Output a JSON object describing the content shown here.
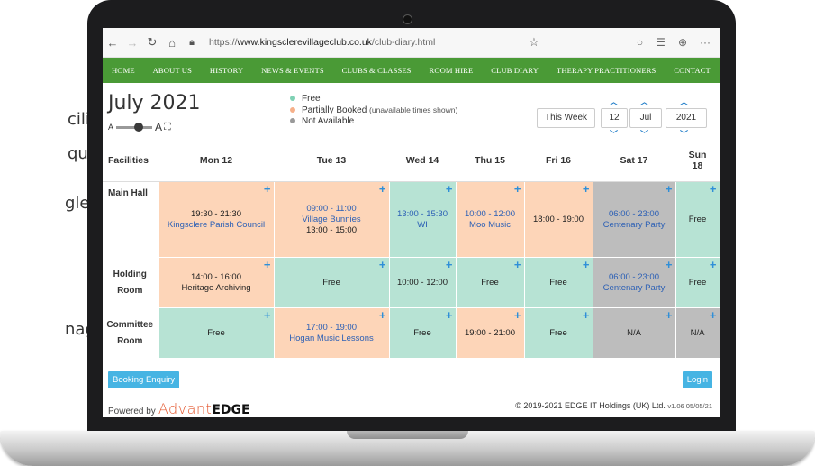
{
  "marketing": [
    "cilities.",
    "quiries",
    "gle",
    "nage"
  ],
  "browser": {
    "url_prefix": "https://",
    "url_domain": "www.kingsclerevillageclub.co.uk",
    "url_path": "/club-diary.html"
  },
  "nav": [
    "HOME",
    "ABOUT US",
    "HISTORY",
    "NEWS & EVENTS",
    "CLUBS & CLASSES",
    "ROOM HIRE",
    "CLUB DIARY",
    "THERAPY PRACTITIONERS",
    "CONTACT"
  ],
  "header": {
    "month_title": "July 2021",
    "zoom_small": "A",
    "zoom_large": "A",
    "legend": {
      "free": "Free",
      "partial": "Partially Booked",
      "partial_note": "(unavailable times shown)",
      "na": "Not Available"
    },
    "this_week": "This Week",
    "day": "12",
    "month": "Jul",
    "year": "2021"
  },
  "colors": {
    "nav_green": "#4a9a36",
    "free": "#b7e3d4",
    "partial": "#fdd5b8",
    "not_available": "#bdbdbd",
    "accent_blue": "#2f8fd8",
    "button_blue": "#46b4e3"
  },
  "table": {
    "facilities_header": "Facilities",
    "days": [
      "Mon 12",
      "Tue 13",
      "Wed 14",
      "Thu 15",
      "Fri 16",
      "Sat 17"
    ],
    "sun_day": "Sun",
    "sun_date": "18",
    "rows": [
      {
        "name": "Main Hall",
        "cells": [
          {
            "status": "part",
            "time": "19:30 - 21:30",
            "event": "Kingsclere Parish Council"
          },
          {
            "status": "part",
            "time": "09:00 - 11:00",
            "event": "Village Bunnies",
            "extra": "13:00 - 15:00"
          },
          {
            "status": "free",
            "time": "13:00 - 15:30",
            "event": "WI"
          },
          {
            "status": "part",
            "time": "10:00 - 12:00",
            "event": "Moo Music"
          },
          {
            "status": "part",
            "time": "18:00 - 19:00"
          },
          {
            "status": "na",
            "time": "06:00 - 23:00",
            "event": "Centenary Party"
          },
          {
            "status": "free",
            "time": "Free"
          }
        ]
      },
      {
        "name_line1": "Holding",
        "name_line2": "Room",
        "cells": [
          {
            "status": "part",
            "time": "14:00 - 16:00",
            "event": "Heritage Archiving"
          },
          {
            "status": "free",
            "time": "Free"
          },
          {
            "status": "free",
            "time": "10:00 - 12:00"
          },
          {
            "status": "free",
            "time": "Free"
          },
          {
            "status": "free",
            "time": "Free"
          },
          {
            "status": "na",
            "time": "06:00 - 23:00",
            "event": "Centenary Party"
          },
          {
            "status": "free",
            "time": "Free"
          }
        ]
      },
      {
        "name_line1": "Committee",
        "name_line2": "Room",
        "cells": [
          {
            "status": "free",
            "time": "Free"
          },
          {
            "status": "part",
            "time": "17:00 - 19:00",
            "event": "Hogan Music Lessons"
          },
          {
            "status": "free",
            "time": "Free"
          },
          {
            "status": "part",
            "time": "19:00 - 21:00"
          },
          {
            "status": "free",
            "time": "Free"
          },
          {
            "status": "na",
            "time": "N/A"
          },
          {
            "status": "na",
            "time": "N/A"
          }
        ]
      }
    ]
  },
  "footer": {
    "booking_enquiry": "Booking Enquiry",
    "login": "Login",
    "powered_by": "Powered by",
    "logo_advant": "Advant",
    "logo_edge": "EDGE",
    "copyright": "© 2019-2021 EDGE IT Holdings (UK) Ltd.",
    "version": "v1.06 05/05/21"
  }
}
